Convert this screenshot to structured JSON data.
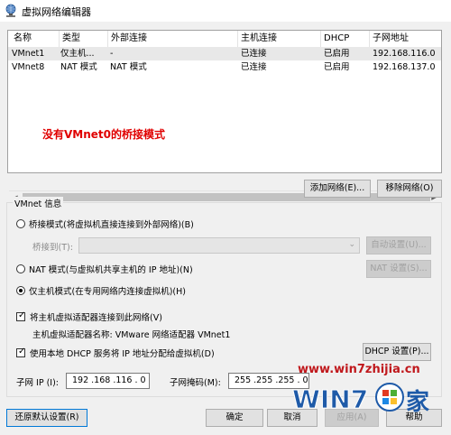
{
  "window": {
    "title": "虚拟网络编辑器"
  },
  "table": {
    "headers": [
      "名称",
      "类型",
      "外部连接",
      "主机连接",
      "DHCP",
      "子网地址"
    ],
    "rows": [
      [
        "VMnet1",
        "仅主机...",
        "-",
        "已连接",
        "已启用",
        "192.168.116.0"
      ],
      [
        "VMnet8",
        "NAT 模式",
        "NAT 模式",
        "已连接",
        "已启用",
        "192.168.137.0"
      ]
    ],
    "annotation": "没有VMnet0的桥接模式"
  },
  "buttons": {
    "add_network": "添加网络(E)...",
    "remove_network": "移除网络(O)",
    "auto_settings": "自动设置(U)...",
    "nat_settings": "NAT 设置(S)...",
    "dhcp_settings": "DHCP 设置(P)...",
    "restore_defaults": "还原默认设置(R)",
    "ok": "确定",
    "cancel": "取消",
    "apply": "应用(A)",
    "help": "帮助"
  },
  "vmnet_info": {
    "group_label": "VMnet 信息",
    "bridged_label": "桥接模式(将虚拟机直接连接到外部网络)(B)",
    "bridged_to_label": "桥接到(T):",
    "bridged_to_value": "",
    "nat_label": "NAT 模式(与虚拟机共享主机的 IP 地址)(N)",
    "hostonly_label": "仅主机模式(在专用网络内连接虚拟机)(H)",
    "selected_mode": "hostonly",
    "connect_adapter_label": "将主机虚拟适配器连接到此网络(V)",
    "connect_adapter_checked": true,
    "adapter_name_text": "主机虚拟适配器名称: VMware 网络适配器 VMnet1",
    "dhcp_label": "使用本地 DHCP 服务将 IP 地址分配给虚拟机(D)",
    "dhcp_checked": true,
    "subnet_ip_label": "子网 IP (I):",
    "subnet_ip_value": "192 .168 .116 . 0",
    "subnet_mask_label": "子网掩码(M):",
    "subnet_mask_value": "255 .255 .255 . 0"
  },
  "watermark": {
    "url": "www.win7zhijia.cn",
    "brand": "WIN7",
    "suffix": "之家"
  },
  "colors": {
    "annotation": "#e00000",
    "watermark_red": "#c0181c",
    "watermark_blue": "#1e5aa8",
    "focus_blue": "#0078d7"
  }
}
